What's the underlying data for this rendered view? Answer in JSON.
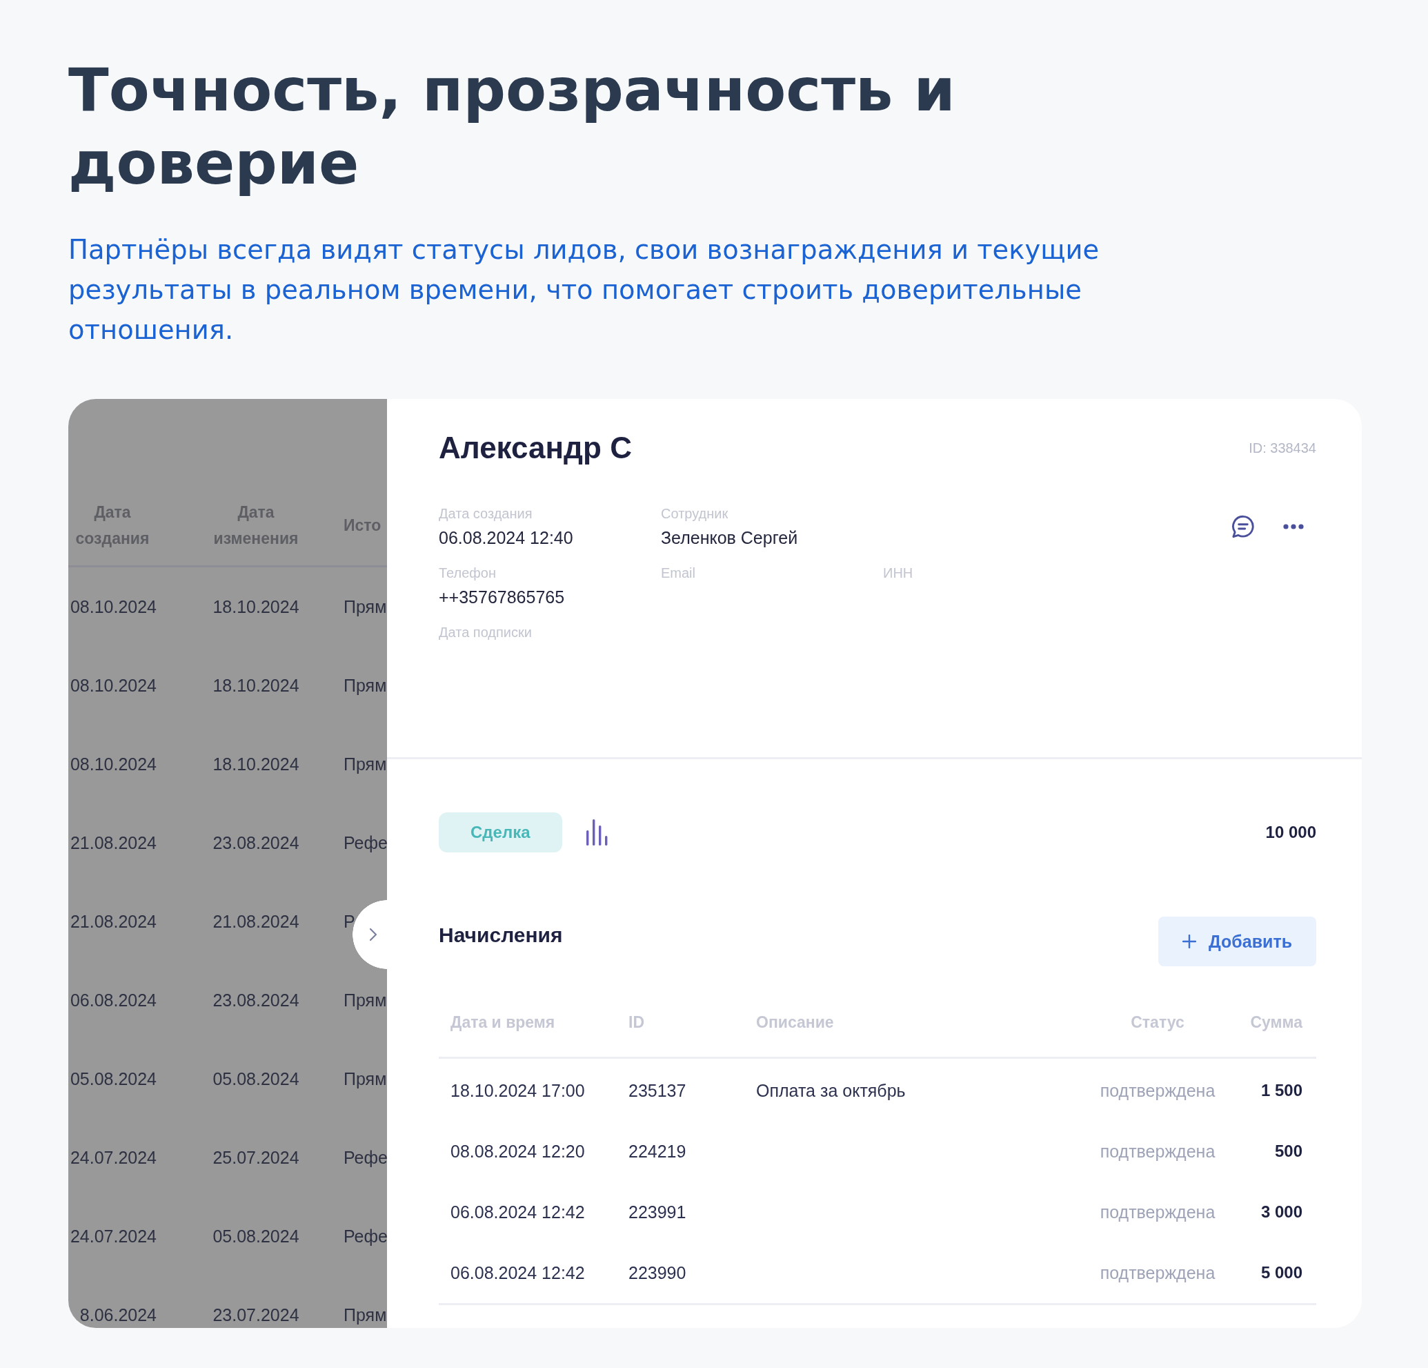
{
  "heading": "Точность, прозрачность и доверие",
  "description": "Партнёры всегда видят статусы лидов, свои вознаграждения и текущие результаты в реальном времени, что помогает строить доверительные отношения.",
  "leads_table": {
    "columns": [
      "Дата создания",
      "Дата изменения",
      "Исто"
    ],
    "rows": [
      [
        "08.10.2024",
        "18.10.2024",
        "Прям"
      ],
      [
        "08.10.2024",
        "18.10.2024",
        "Прям"
      ],
      [
        "08.10.2024",
        "18.10.2024",
        "Прям"
      ],
      [
        "21.08.2024",
        "23.08.2024",
        "Рефе"
      ],
      [
        "21.08.2024",
        "21.08.2024",
        "Р"
      ],
      [
        "06.08.2024",
        "23.08.2024",
        "Прям"
      ],
      [
        "05.08.2024",
        "05.08.2024",
        "Прям"
      ],
      [
        "24.07.2024",
        "25.07.2024",
        "Рефе"
      ],
      [
        "24.07.2024",
        "05.08.2024",
        "Рефе"
      ],
      [
        "8.06.2024",
        "23.07.2024",
        "Прям"
      ]
    ]
  },
  "lead": {
    "name": "Александр С",
    "id": "ID: 338434",
    "fields": [
      [
        {
          "label": "Дата создания",
          "value": "06.08.2024 12:40"
        },
        {
          "label": "Сотрудник",
          "value": "Зеленков Сергей"
        }
      ],
      [
        {
          "label": "Телефон",
          "value": "++35767865765"
        },
        {
          "label": "Email"
        },
        {
          "label": "ИНН"
        }
      ],
      [
        {
          "label": "Дата подписки"
        }
      ]
    ],
    "stage": "Сделка",
    "amount": "10 000"
  },
  "accruals": {
    "title": "Начисления",
    "add_button": "Добавить",
    "columns": [
      "Дата и время",
      "ID",
      "Описание",
      "Статус",
      "Сумма"
    ],
    "rows": [
      {
        "datetime": "18.10.2024 17:00",
        "id": "235137",
        "description": "Оплата за октябрь",
        "status": "подтверждена",
        "amount": "1 500"
      },
      {
        "datetime": "08.08.2024 12:20",
        "id": "224219",
        "status": "подтверждена",
        "amount": "500"
      },
      {
        "datetime": "06.08.2024 12:42",
        "id": "223991",
        "status": "подтверждена",
        "amount": "3 000"
      },
      {
        "datetime": "06.08.2024 12:42",
        "id": "223990",
        "status": "подтверждена",
        "amount": "5 000"
      }
    ]
  }
}
